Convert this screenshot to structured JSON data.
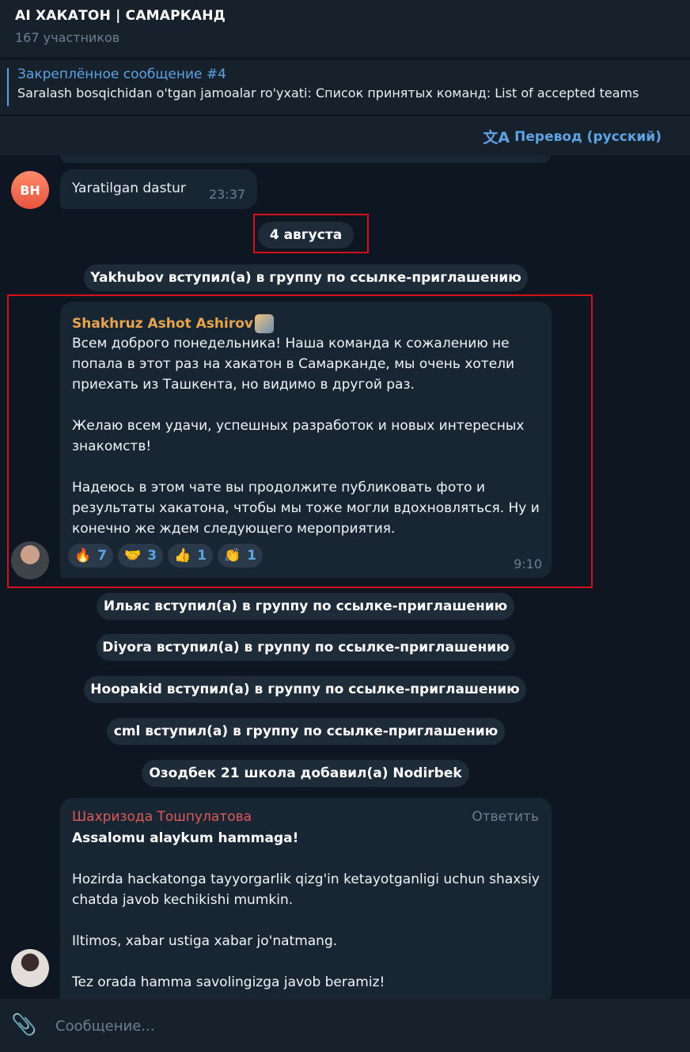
{
  "header": {
    "title": "AI ХАКАТОН | САМАРКАНД",
    "subtitle": "167 участников"
  },
  "pinned": {
    "title": "Закреплённое сообщение #4",
    "text": "Saralash bosqichidan o'tgan jamoalar ro'yxati: Список принятых команд: List of accepted teams"
  },
  "translate": {
    "icon": "文A",
    "label": "Перевод (русский)"
  },
  "messages": {
    "prev": {
      "avatar_initials": "BH",
      "text": "Yaratilgan dastur",
      "time": "23:37"
    },
    "date_chip": "4 августа",
    "joined_1": "Yakhubov вступил(а) в группу по ссылке-приглашению",
    "highlight": {
      "sender": "Shakhruz Ashot Ashirov",
      "para1": "Всем доброго понедельника! Наша команда к сожалению не попала в этот раз на хакатон в Самарканде, мы очень хотели приехать из Ташкента, но видимо в другой раз.",
      "para2": "Желаю всем удачи, успешных разработок и новых интересных знакомств!",
      "para3": "Надеюсь в этом чате вы продолжите публиковать фото и результаты хакатона, чтобы мы тоже могли вдохновляться. Ну и конечно же ждем следующего мероприятия.",
      "time": "9:10",
      "reactions": [
        {
          "emoji": "🔥",
          "count": "7"
        },
        {
          "emoji": "🤝",
          "count": "3"
        },
        {
          "emoji": "👍",
          "count": "1"
        },
        {
          "emoji": "👏",
          "count": "1"
        }
      ]
    },
    "joined_2": "Ильяс вступил(а) в группу по ссылке-приглашению",
    "joined_3": "Diyora вступил(а) в группу по ссылке-приглашению",
    "joined_4": "Hoopakid вступил(а) в группу по ссылке-приглашению",
    "joined_5": "cml вступил(а) в группу по ссылке-приглашению",
    "added": "Озодбек 21 школа добавил(а) Nodirbek",
    "last": {
      "sender": "Шахризода Тошпулатова",
      "reply_label": "Ответить",
      "line1": "Assalomu alaykum hammaga!",
      "line2": "Hozirda hackatonga tayyorgarlik qizg'in ketayotganligi uchun shaxsiy chatda javob kechikishi mumkin.",
      "line3": "Iltimos, xabar ustiga xabar jo'natmang.",
      "line4": "Tez orada hamma savolingizga javob beramiz!"
    }
  },
  "composer": {
    "placeholder": "Сообщение..."
  },
  "colors": {
    "background": "#0e1621",
    "bubble": "#182533",
    "accent": "#5ea3e6",
    "highlight_border": "#d2121a"
  }
}
